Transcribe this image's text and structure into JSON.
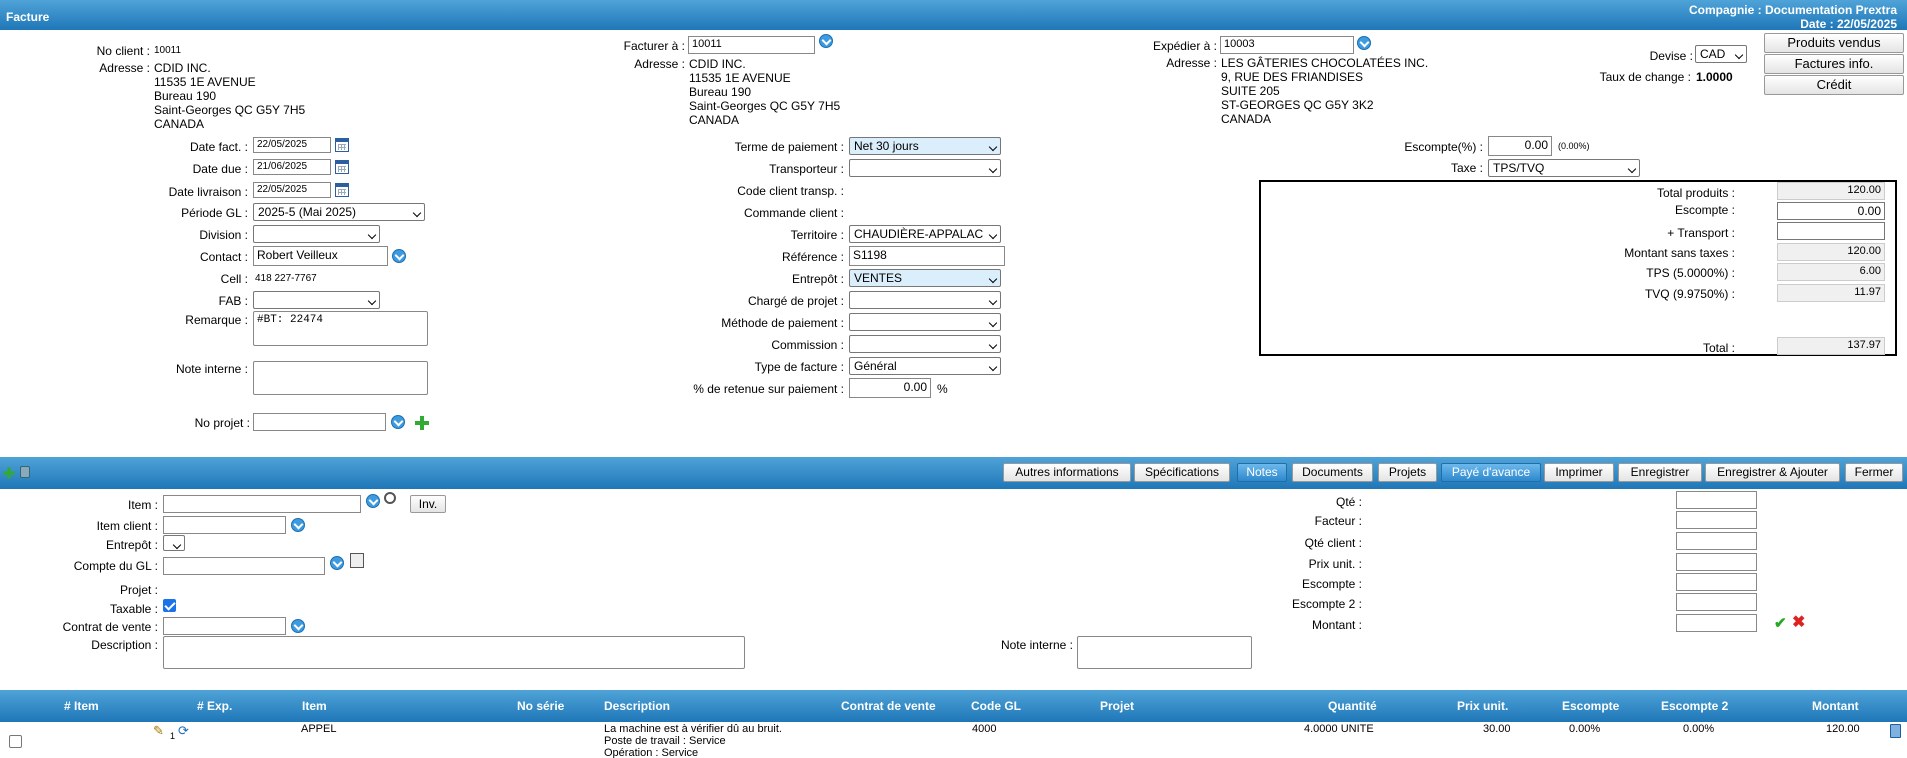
{
  "header": {
    "title": "Facture",
    "company": "Compagnie : Documentation Prextra",
    "date": "Date : 22/05/2025"
  },
  "client": {
    "no_label": "No client :",
    "no": "10011",
    "addr_label": "Adresse :",
    "addr": [
      "CDID INC.",
      "11535 1E AVENUE",
      "Bureau 190",
      "Saint-Georges QC G5Y 7H5",
      "CANADA"
    ]
  },
  "billto": {
    "label": "Facturer à :",
    "value": "10011",
    "addr_label": "Adresse :",
    "addr": [
      "CDID INC.",
      "11535 1E AVENUE",
      "Bureau 190",
      "Saint-Georges QC G5Y 7H5",
      "CANADA"
    ]
  },
  "shipto": {
    "label": "Expédier à :",
    "value": "10003",
    "addr_label": "Adresse :",
    "addr": [
      "LES GÂTERIES CHOCOLATÉES INC.",
      "9, RUE DES FRIANDISES",
      "SUITE 205",
      "ST-GEORGES QC G5Y 3K2",
      "CANADA"
    ]
  },
  "currency": {
    "label": "Devise :",
    "value": "CAD",
    "rate_label": "Taux de change :",
    "rate": "1.0000"
  },
  "side_buttons": {
    "sold": "Produits vendus",
    "info": "Factures info.",
    "credit": "Crédit"
  },
  "left": {
    "date_fact_label": "Date fact. :",
    "date_fact": "22/05/2025",
    "date_due_label": "Date due :",
    "date_due": "21/06/2025",
    "date_liv_label": "Date livraison :",
    "date_liv": "22/05/2025",
    "periode_label": "Période GL :",
    "periode": "2025-5 (Mai 2025)",
    "division_label": "Division :",
    "division": "",
    "contact_label": "Contact :",
    "contact": "Robert Veilleux",
    "cell_label": "Cell :",
    "cell": "418 227-7767",
    "fab_label": "FAB :",
    "fab": "",
    "remarque_label": "Remarque :",
    "remarque": "#BT: 22474",
    "note_label": "Note interne :",
    "note": "",
    "projet_label": "No projet :",
    "projet": ""
  },
  "mid": {
    "terme_label": "Terme de paiement :",
    "terme": "Net 30 jours",
    "transp_label": "Transporteur :",
    "transp": "",
    "code_label": "Code client transp. :",
    "commande_label": "Commande client :",
    "territoire_label": "Territoire :",
    "territoire": "CHAUDIÈRE-APPALAC",
    "reference_label": "Référence :",
    "reference": "S1198",
    "entrepot_label": "Entrepôt :",
    "entrepot": "VENTES",
    "charge_label": "Chargé de projet :",
    "charge": "",
    "methode_label": "Méthode de paiement :",
    "methode": "",
    "commission_label": "Commission :",
    "commission": "",
    "type_label": "Type de facture :",
    "type": "Général",
    "retenue_label": "% de retenue sur paiement :",
    "retenue": "0.00",
    "retenue_unit": "%"
  },
  "right": {
    "escompte_label": "Escompte(%) :",
    "escompte": "0.00",
    "escompte_pct": "(0.00%)",
    "taxe_label": "Taxe :",
    "taxe": "TPS/TVQ"
  },
  "totals": {
    "produits_label": "Total produits :",
    "produits": "120.00",
    "escompte_label": "Escompte :",
    "escompte": "0.00",
    "transport_label": "+ Transport :",
    "transport": "",
    "sans_taxes_label": "Montant sans taxes :",
    "sans_taxes": "120.00",
    "tps_label": "TPS (5.0000%) :",
    "tps": "6.00",
    "tvq_label": "TVQ (9.9750%) :",
    "tvq": "11.97",
    "total_label": "Total :",
    "total": "137.97"
  },
  "toolbar": {
    "autres": "Autres informations",
    "specs": "Spécifications",
    "notes": "Notes",
    "documents": "Documents",
    "projets": "Projets",
    "paye": "Payé d'avance",
    "imprimer": "Imprimer",
    "enregistrer": "Enregistrer",
    "enreg_ajout": "Enregistrer & Ajouter",
    "fermer": "Fermer"
  },
  "item_form": {
    "item_label": "Item :",
    "inv": "Inv.",
    "item_client_label": "Item client :",
    "entrepot_label": "Entrepôt :",
    "compte_label": "Compte du GL :",
    "projet_label": "Projet :",
    "taxable_label": "Taxable :",
    "contrat_label": "Contrat de vente :",
    "desc_label": "Description :",
    "note_label": "Note interne :",
    "qte_label": "Qté :",
    "facteur_label": "Facteur :",
    "qte_client_label": "Qté client :",
    "prix_label": "Prix unit. :",
    "esc_label": "Escompte :",
    "esc2_label": "Escompte 2 :",
    "montant_label": "Montant :"
  },
  "grid": {
    "headers": {
      "item": "# Item",
      "exp": "# Exp.",
      "item2": "Item",
      "serie": "No série",
      "desc": "Description",
      "contrat": "Contrat de vente",
      "gl": "Code GL",
      "projet": "Projet",
      "qte": "Quantité",
      "prix": "Prix unit.",
      "esc": "Escompte",
      "esc2": "Escompte 2",
      "montant": "Montant"
    },
    "rows": [
      {
        "exp_no": "1",
        "item": "APPEL",
        "desc1": "La machine est à vérifier dû au bruit.",
        "desc2": "Poste de travail : Service",
        "desc3": "Opération : Service",
        "gl": "4000",
        "qte": "4.0000 UNITE",
        "prix": "30.00",
        "esc": "0.00%",
        "esc2": "0.00%",
        "montant": "120.00"
      }
    ]
  }
}
